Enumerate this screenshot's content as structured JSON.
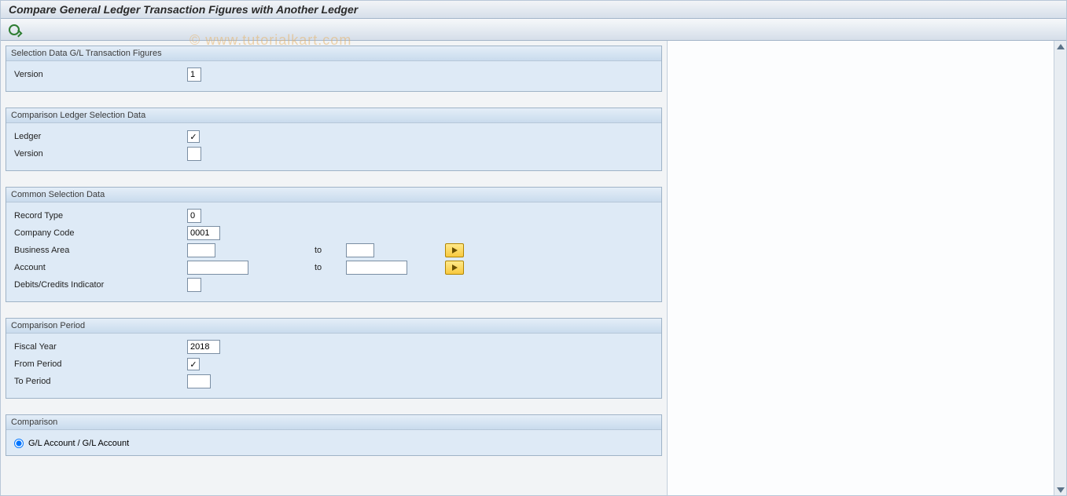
{
  "title": "Compare General Ledger Transaction Figures with Another Ledger",
  "watermark": "© www.tutorialkart.com",
  "toolbar": {
    "execute_tooltip": "Execute"
  },
  "groups": {
    "g1": {
      "title": "Selection Data G/L Transaction Figures",
      "version_label": "Version",
      "version_value": "1"
    },
    "g2": {
      "title": "Comparison Ledger Selection Data",
      "ledger_label": "Ledger",
      "ledger_value": "",
      "version_label": "Version",
      "version_value": ""
    },
    "g3": {
      "title": "Common Selection Data",
      "record_type_label": "Record Type",
      "record_type_value": "0",
      "company_code_label": "Company Code",
      "company_code_value": "0001",
      "business_area_label": "Business Area",
      "business_area_from": "",
      "business_area_to": "",
      "account_label": "Account",
      "account_from": "",
      "account_to": "",
      "to_label": "to",
      "debit_credit_label": "Debits/Credits Indicator",
      "debit_credit_value": ""
    },
    "g4": {
      "title": "Comparison Period",
      "fiscal_year_label": "Fiscal Year",
      "fiscal_year_value": "2018",
      "from_period_label": "From Period",
      "from_period_value": "",
      "to_period_label": "To Period",
      "to_period_value": ""
    },
    "g5": {
      "title": "Comparison",
      "radio1_label": "G/L Account / G/L Account",
      "radio1_checked": true
    }
  }
}
